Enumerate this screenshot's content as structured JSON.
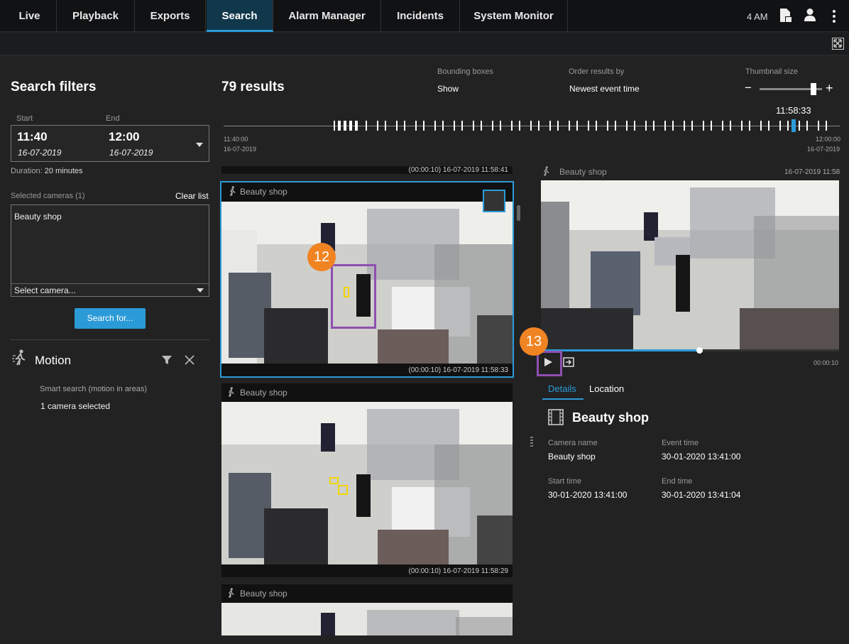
{
  "nav": {
    "tabs": [
      "Live",
      "Playback",
      "Exports",
      "Search",
      "Alarm Manager",
      "Incidents",
      "System Monitor"
    ],
    "time": "4 AM"
  },
  "filters": {
    "title": "Search filters",
    "start_label": "Start",
    "end_label": "End",
    "start_time": "11:40",
    "start_date": "16-07-2019",
    "end_time": "12:00",
    "end_date": "16-07-2019",
    "duration_label": "Duration:",
    "duration_value": "20 minutes",
    "cameras_label": "Selected cameras (1)",
    "clear_list": "Clear list",
    "camera": "Beauty shop",
    "select_camera": "Select camera...",
    "search_button": "Search for...",
    "motion_title": "Motion",
    "motion_sub": "Smart search (motion in areas)",
    "motion_selected": "1 camera selected"
  },
  "results": {
    "count": "79 results",
    "bbox_label": "Bounding boxes",
    "bbox_value": "Show",
    "order_label": "Order results by",
    "order_value": "Newest event time",
    "thumb_label": "Thumbnail size",
    "minus": "−",
    "plus": "+",
    "timeline_current": "11:58:33",
    "timeline_start_time": "11:40:00",
    "timeline_start_date": "16-07-2019",
    "timeline_end_time": "12:00:00",
    "timeline_end_date": "16-07-2019",
    "thumbnail_size": 0.9
  },
  "cards": [
    {
      "camera": "",
      "stamp": "(00:00:10)    16-07-2019  11:58:41"
    },
    {
      "camera": "Beauty shop",
      "stamp": "(00:00:10)    16-07-2019  11:58:33"
    },
    {
      "camera": "Beauty shop",
      "stamp": "(00:00:10)    16-07-2019  11:58:29"
    },
    {
      "camera": "Beauty shop",
      "stamp": ""
    }
  ],
  "badges": {
    "first": "12",
    "second": "13"
  },
  "preview": {
    "camera": "Beauty shop",
    "date": "16-07-2019 11:58",
    "duration": "00:00:10",
    "playback_progress": 0.53,
    "tab_details": "Details",
    "tab_location": "Location",
    "title": "Beauty shop",
    "camera_name_label": "Camera name",
    "camera_name_value": "Beauty shop",
    "event_time_label": "Event time",
    "event_time_value": "30-01-2020 13:41:00",
    "start_time_label": "Start time",
    "start_time_value": "30-01-2020 13:41:00",
    "end_time_label": "End time",
    "end_time_value": "30-01-2020 13:41:04"
  },
  "colors": {
    "accent": "#2b9bd8",
    "badge": "#f08422",
    "highlight": "#8e4fb0"
  }
}
